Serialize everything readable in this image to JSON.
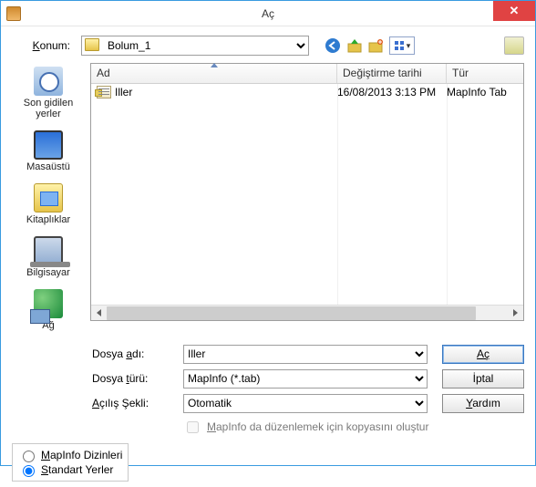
{
  "title": "Aç",
  "location": {
    "label": "Konum:",
    "value": "Bolum_1",
    "icons": {
      "back": "back-icon",
      "up": "up-icon",
      "newfolder": "new-folder-icon",
      "view": "view-menu-icon",
      "mapinfo": "mapinfo-places-icon"
    }
  },
  "columns": {
    "name": "Ad",
    "date": "Değiştirme tarihi",
    "type": "Tür"
  },
  "rows": [
    {
      "name": "Iller",
      "date": "16/08/2013 3:13 PM",
      "type": "MapInfo Tab"
    }
  ],
  "sidebar": [
    {
      "id": "recent",
      "label": "Son gidilen yerler"
    },
    {
      "id": "desktop",
      "label": "Masaüstü"
    },
    {
      "id": "libraries",
      "label": "Kitaplıklar"
    },
    {
      "id": "computer",
      "label": "Bilgisayar"
    },
    {
      "id": "network",
      "label": "Ağ"
    }
  ],
  "form": {
    "filename_label": "Dosya adı:",
    "filename_value": "Iller",
    "filetype_label": "Dosya türü:",
    "filetype_value": "MapInfo (*.tab)",
    "openmode_label": "Açılış Şekli:",
    "openmode_value": "Otomatik",
    "checkbox_label": "MapInfo da düzenlemek için kopyasını oluştur",
    "checkbox_checked": false
  },
  "buttons": {
    "open": "Aç",
    "cancel": "İptal",
    "help": "Yardım"
  },
  "radios": {
    "mapinfo": "MapInfo Dizinleri",
    "standard": "Standart Yerler",
    "selected": "standard"
  }
}
